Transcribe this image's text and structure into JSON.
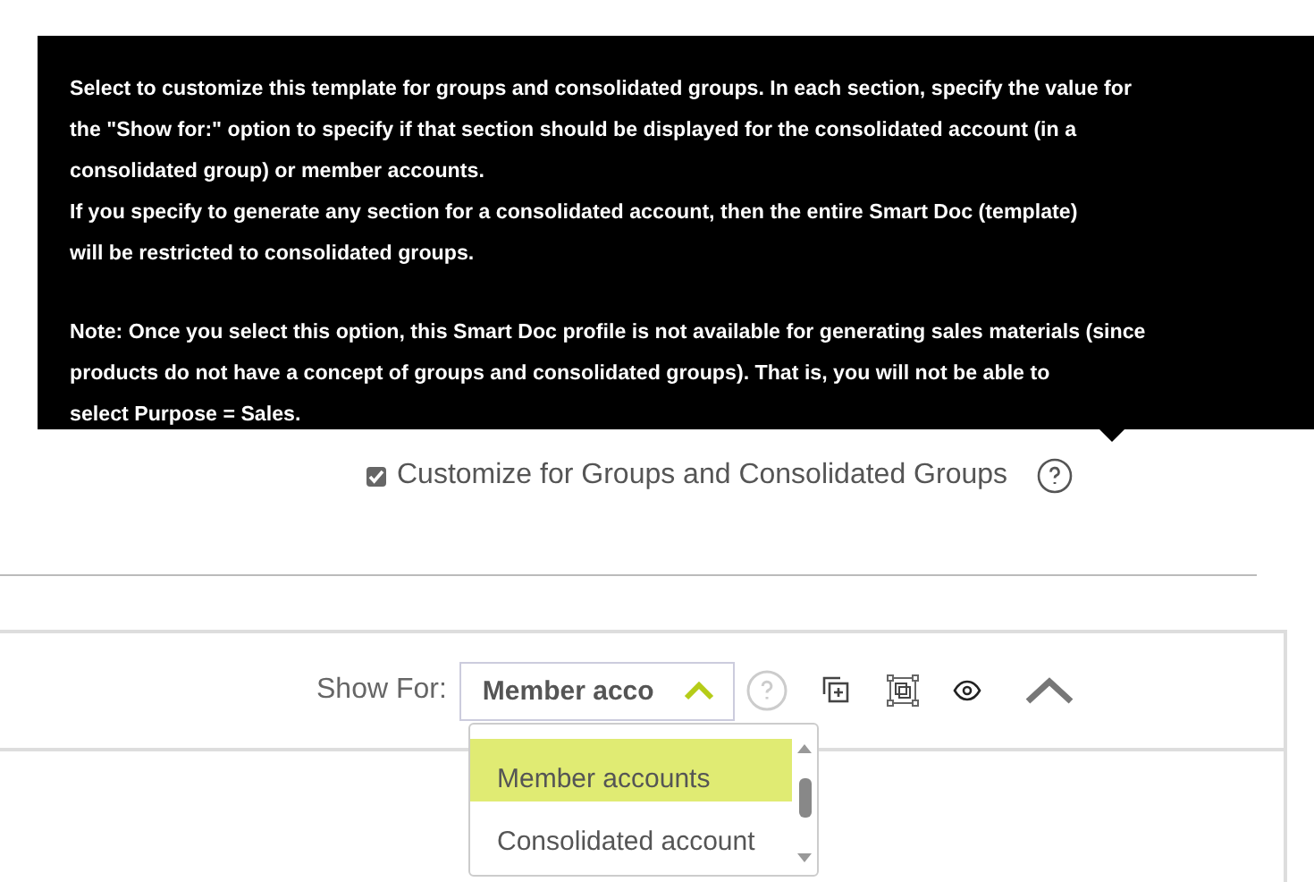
{
  "tooltip": {
    "paragraphs": [
      {
        "lines": [
          "Select to customize this template for groups and consolidated groups. In each section, specify the value for",
          "the \"Show for:\" option to specify if that section should be displayed for the consolidated account (in a",
          "consolidated group) or member accounts.",
          "If you specify to generate any section for a consolidated account, then the entire Smart Doc (template)",
          "will be restricted to consolidated groups."
        ]
      },
      {
        "lines": [
          "Note: Once you select this option, this Smart Doc profile is not available for generating sales materials (since",
          "products do not have a concept of groups and consolidated groups). That is, you will not be able to",
          "select Purpose = Sales."
        ]
      }
    ]
  },
  "customize_checkbox": {
    "label": "Customize for Groups and Consolidated Groups",
    "checked": true
  },
  "section": {
    "show_for_label": "Show For:",
    "select": {
      "value": "Member acco",
      "expanded": true
    },
    "options": [
      {
        "label": "Member accounts",
        "selected": true
      },
      {
        "label": "Consolidated account",
        "selected": false
      }
    ]
  }
}
